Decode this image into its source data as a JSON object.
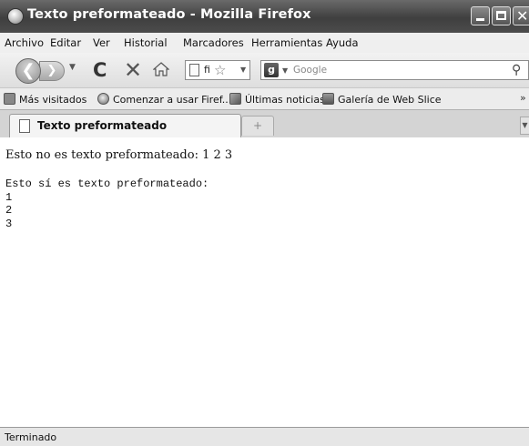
{
  "window": {
    "title": "Texto preformateado - Mozilla Firefox"
  },
  "menu": [
    "Archivo",
    "Editar",
    "Ver",
    "Historial",
    "Marcadores",
    "Herramientas",
    "Ayuda"
  ],
  "nav": {
    "url_fragment": "fi",
    "search_placeholder": "Google"
  },
  "bookmarks": [
    {
      "label": "Más visitados",
      "icon": "folder-icon"
    },
    {
      "label": "Comenzar a usar Firef...",
      "icon": "firefox-icon"
    },
    {
      "label": "Últimas noticias",
      "icon": "rss-feed-icon"
    },
    {
      "label": "Galería de Web Slice",
      "icon": "web-slice-icon"
    }
  ],
  "tabs": [
    {
      "label": "Texto preformateado",
      "active": true
    }
  ],
  "content": {
    "normal_text": "Esto no es texto preformateado: 1 2 3",
    "pre_text": "Esto sí es texto preformateado:\n1\n2\n3"
  },
  "status": "Terminado"
}
